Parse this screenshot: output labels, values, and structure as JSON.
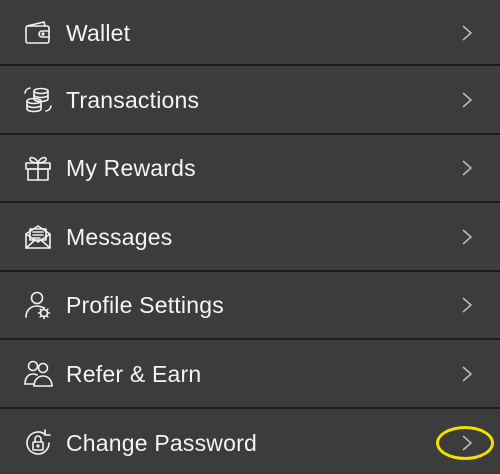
{
  "menu": {
    "items": [
      {
        "label": "Wallet",
        "icon": "wallet-icon"
      },
      {
        "label": "Transactions",
        "icon": "coins-icon"
      },
      {
        "label": "My Rewards",
        "icon": "gift-icon"
      },
      {
        "label": "Messages",
        "icon": "envelope-icon"
      },
      {
        "label": "Profile Settings",
        "icon": "user-gear-icon"
      },
      {
        "label": "Refer & Earn",
        "icon": "users-icon"
      },
      {
        "label": "Change Password",
        "icon": "lock-refresh-icon"
      }
    ],
    "highlight_color": "#f4e000",
    "background_color": "#3c3c3c",
    "divider_color": "#1a1a1a"
  }
}
